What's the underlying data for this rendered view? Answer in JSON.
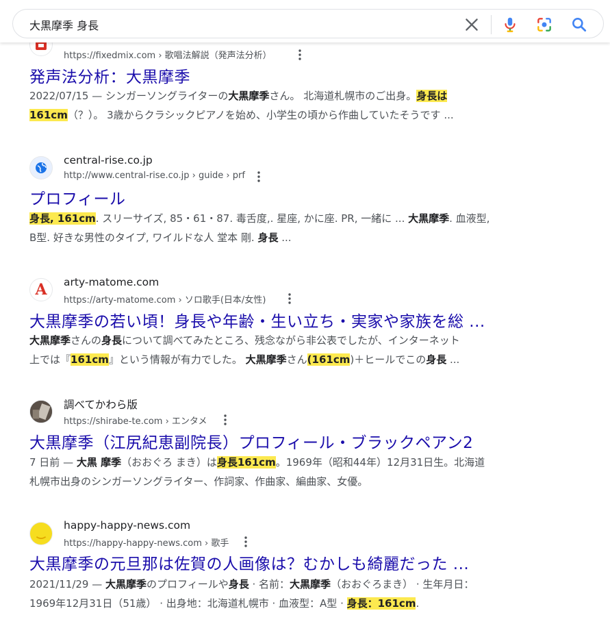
{
  "search": {
    "query": "大黒摩季 身長"
  },
  "results": [
    {
      "url": "https://fixedmix.com › 歌唱法解説（発声法分析）",
      "title": "発声法分析：大黒摩季",
      "snippet_lines": [
        [
          {
            "t": "2022/07/15 — シンガーソングライターの"
          },
          {
            "t": "大黒摩季",
            "b": true
          },
          {
            "t": "さん。 北海道札幌市のご出身。"
          },
          {
            "t": "身長は",
            "b": true,
            "h": true
          }
        ],
        [
          {
            "t": "161cm",
            "b": true,
            "h": true
          },
          {
            "t": "（？）。 3歳からクラシックピアノを始め、小学生の頃から作曲していたそうです ..."
          }
        ]
      ]
    },
    {
      "site": "central-rise.co.jp",
      "url": "http://www.central-rise.co.jp › guide › prf",
      "title": "プロフィール",
      "snippet_lines": [
        [
          {
            "t": "身長, 161cm",
            "b": true,
            "h": true
          },
          {
            "t": ". スリーサイズ, 85・61・87. 毒舌度,. 星座, かに座. PR, 一緒に ... "
          },
          {
            "t": "大黒摩季",
            "b": true
          },
          {
            "t": ". 血液型,"
          }
        ],
        [
          {
            "t": "B型. 好きな男性のタイプ, ワイルドな人 堂本 剛. "
          },
          {
            "t": "身長",
            "b": true
          },
          {
            "t": " ..."
          }
        ]
      ]
    },
    {
      "site": "arty-matome.com",
      "url": "https://arty-matome.com › ソロ歌手(日本/女性)",
      "title": "大黒摩季の若い頃！身長や年齢・生い立ち・実家や家族を総 ...",
      "snippet_lines": [
        [
          {
            "t": "大黒摩季",
            "b": true
          },
          {
            "t": "さんの"
          },
          {
            "t": "身長",
            "b": true
          },
          {
            "t": "について調べてみたところ、残念ながら非公表でしたが、インターネット"
          }
        ],
        [
          {
            "t": "上では『"
          },
          {
            "t": "161cm",
            "b": true,
            "h": true
          },
          {
            "t": "』という情報が有力でした。 "
          },
          {
            "t": "大黒摩季",
            "b": true
          },
          {
            "t": "さん"
          },
          {
            "t": "(161cm",
            "b": true,
            "h": true
          },
          {
            "t": ")＋ヒールでこの"
          },
          {
            "t": "身長",
            "b": true
          },
          {
            "t": " ..."
          }
        ]
      ]
    },
    {
      "site": "調べてかわら版",
      "url": "https://shirabe-te.com › エンタメ",
      "title": "大黒摩季（江尻紀恵副院長）プロフィール・ブラックペアン2",
      "snippet_lines": [
        [
          {
            "t": "7 日前 — "
          },
          {
            "t": "大黒 摩季",
            "b": true
          },
          {
            "t": "（おおぐろ まき）は"
          },
          {
            "t": "身長161cm",
            "b": true,
            "h": true
          },
          {
            "t": "。1969年（昭和44年）12月31日生。北海道"
          }
        ],
        [
          {
            "t": "札幌市出身のシンガーソングライター、作詞家、作曲家、編曲家、女優。"
          }
        ]
      ]
    },
    {
      "site": "happy-happy-news.com",
      "url": "https://happy-happy-news.com › 歌手",
      "title": "大黒摩季の元旦那は佐賀の人画像は？むかしも綺麗だった ...",
      "snippet_lines": [
        [
          {
            "t": "2021/11/29 — "
          },
          {
            "t": "大黒摩季",
            "b": true
          },
          {
            "t": "のプロフィールや"
          },
          {
            "t": "身長",
            "b": true
          },
          {
            "t": " · 名前："
          },
          {
            "t": "大黒摩季",
            "b": true
          },
          {
            "t": "（おおぐろまき） · 生年月日："
          }
        ],
        [
          {
            "t": "1969年12月31日（51歳） · 出身地：北海道札幌市 · 血液型：A型 · "
          },
          {
            "t": "身長：161cm",
            "b": true,
            "h": true
          },
          {
            "t": "."
          }
        ]
      ]
    }
  ]
}
